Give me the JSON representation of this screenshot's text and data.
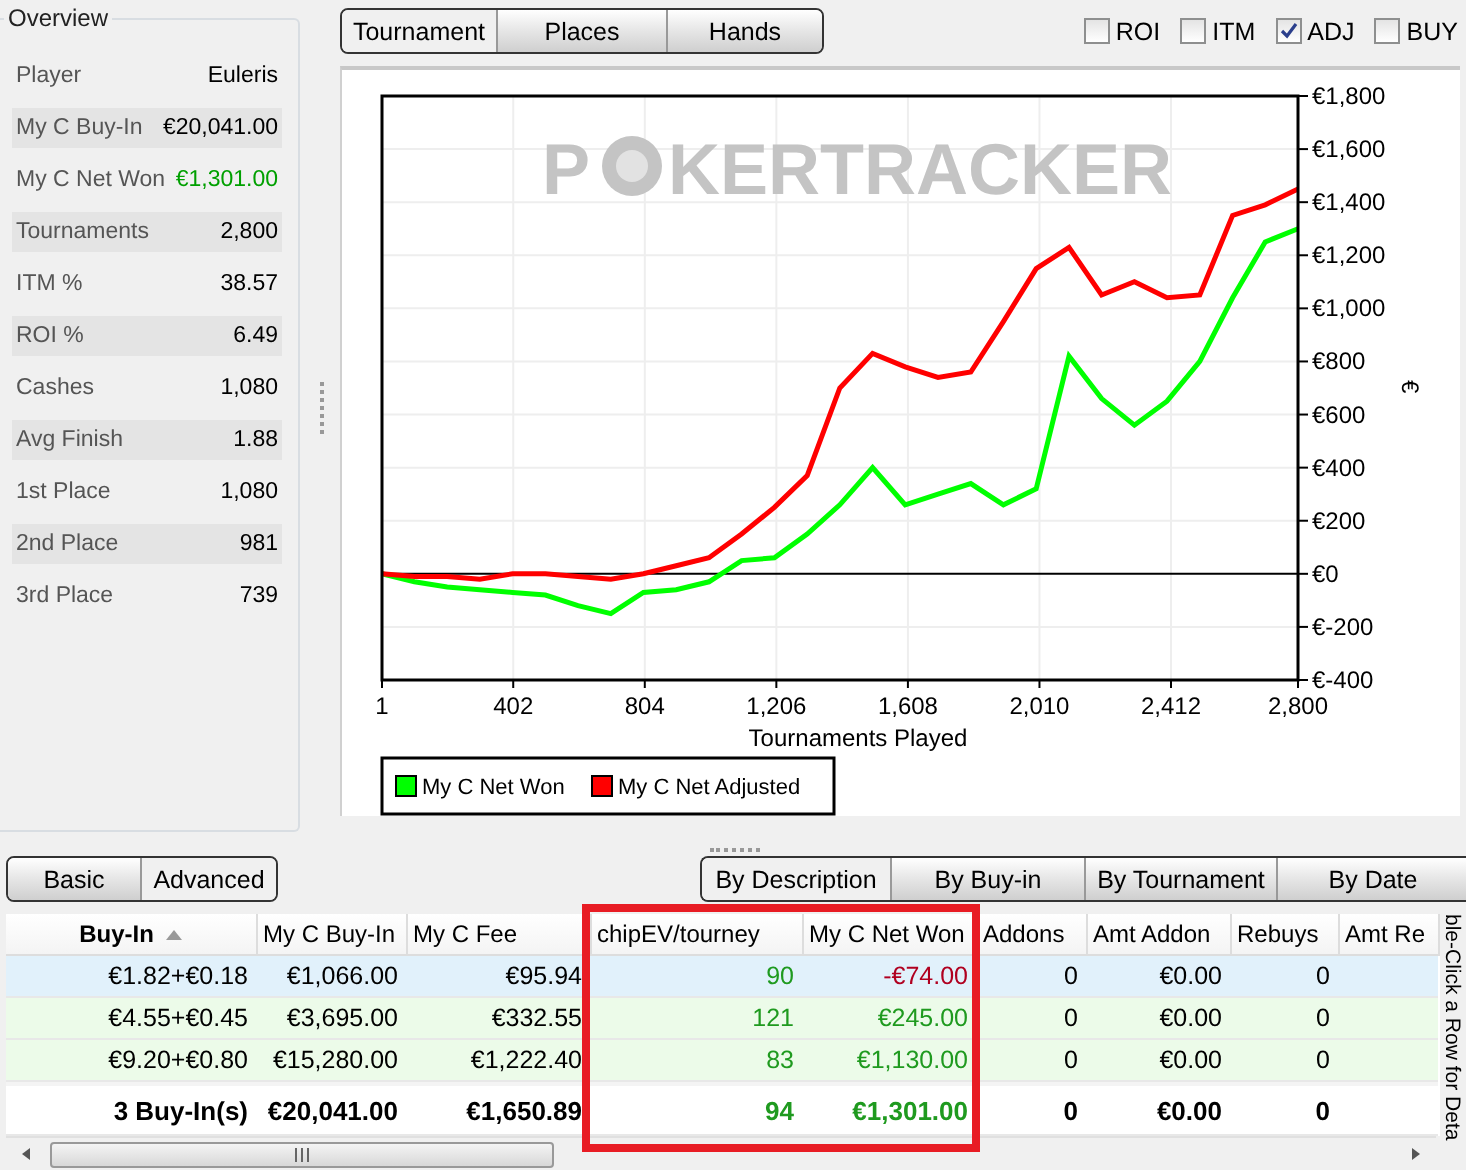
{
  "overview": {
    "title": "Overview",
    "rows": [
      {
        "label": "Player",
        "value": "Euleris"
      },
      {
        "label": "My C Buy-In",
        "value": "€20,041.00"
      },
      {
        "label": "My C Net Won",
        "value": "€1,301.00",
        "color": "#00a000"
      },
      {
        "label": "Tournaments",
        "value": "2,800"
      },
      {
        "label": "ITM %",
        "value": "38.57"
      },
      {
        "label": "ROI %",
        "value": "6.49"
      },
      {
        "label": "Cashes",
        "value": "1,080"
      },
      {
        "label": "Avg Finish",
        "value": "1.88"
      },
      {
        "label": "1st Place",
        "value": "1,080"
      },
      {
        "label": "2nd Place",
        "value": "981"
      },
      {
        "label": "3rd Place",
        "value": "739"
      }
    ]
  },
  "view_tabs": [
    {
      "label": "Tournament",
      "selected": true
    },
    {
      "label": "Places",
      "selected": false
    },
    {
      "label": "Hands",
      "selected": false
    }
  ],
  "options": [
    {
      "label": "ROI",
      "checked": false
    },
    {
      "label": "ITM",
      "checked": false
    },
    {
      "label": "ADJ",
      "checked": true
    },
    {
      "label": "BUY",
      "checked": false
    }
  ],
  "chart": {
    "watermark": [
      "P",
      "KERTRACKER"
    ],
    "chart_data": {
      "type": "line",
      "grid": true,
      "legend": true,
      "xlabel": "Tournaments Played",
      "ylabel": "€",
      "x": [
        1,
        100,
        200,
        300,
        400,
        500,
        600,
        700,
        800,
        900,
        1000,
        1100,
        1200,
        1300,
        1400,
        1500,
        1600,
        1700,
        1800,
        1900,
        2000,
        2100,
        2200,
        2300,
        2400,
        2500,
        2600,
        2700,
        2800
      ],
      "series": [
        {
          "name": "My C Net Won",
          "color": "#00ff00",
          "values": [
            0,
            -30,
            -50,
            -60,
            -70,
            -80,
            -120,
            -150,
            -70,
            -60,
            -30,
            50,
            60,
            150,
            260,
            400,
            260,
            300,
            340,
            260,
            320,
            820,
            660,
            560,
            650,
            800,
            1040,
            1250,
            1300
          ]
        },
        {
          "name": "My C Net Adjusted",
          "color": "#ff0000",
          "values": [
            0,
            -10,
            -10,
            -20,
            0,
            0,
            -10,
            -20,
            0,
            30,
            60,
            150,
            250,
            370,
            700,
            830,
            780,
            740,
            760,
            950,
            1150,
            1230,
            1050,
            1100,
            1040,
            1050,
            1350,
            1390,
            1450
          ]
        }
      ],
      "xlim": [
        1,
        2800
      ],
      "ylim": [
        -400,
        1800
      ],
      "xticks": [
        {
          "value": 1,
          "label": "1"
        },
        {
          "value": 402,
          "label": "402"
        },
        {
          "value": 804,
          "label": "804"
        },
        {
          "value": 1206,
          "label": "1,206"
        },
        {
          "value": 1608,
          "label": "1,608"
        },
        {
          "value": 2010,
          "label": "2,010"
        },
        {
          "value": 2412,
          "label": "2,412"
        },
        {
          "value": 2800,
          "label": "2,800"
        }
      ],
      "yticks": [
        {
          "value": 1800,
          "label": "€1,800"
        },
        {
          "value": 1600,
          "label": "€1,600"
        },
        {
          "value": 1400,
          "label": "€1,400"
        },
        {
          "value": 1200,
          "label": "€1,200"
        },
        {
          "value": 1000,
          "label": "€1,000"
        },
        {
          "value": 800,
          "label": "€800"
        },
        {
          "value": 600,
          "label": "€600"
        },
        {
          "value": 400,
          "label": "€400"
        },
        {
          "value": 200,
          "label": "€200"
        },
        {
          "value": 0,
          "label": "€0"
        },
        {
          "value": -200,
          "label": "€-200"
        },
        {
          "value": -400,
          "label": "€-400"
        }
      ]
    }
  },
  "mode_tabs": [
    {
      "label": "Basic",
      "selected": false
    },
    {
      "label": "Advanced",
      "selected": true
    }
  ],
  "group_tabs": [
    {
      "label": "By Description",
      "selected": true
    },
    {
      "label": "By Buy-in",
      "selected": false
    },
    {
      "label": "By Tournament",
      "selected": false
    },
    {
      "label": "By Date",
      "selected": false
    }
  ],
  "table": {
    "columns": [
      {
        "label": "Buy-In",
        "sorted": true,
        "highlighted": false
      },
      {
        "label": "My C Buy-In",
        "highlighted": false
      },
      {
        "label": "My C Fee",
        "highlighted": false
      },
      {
        "label": "chipEV/tourney",
        "highlighted": true
      },
      {
        "label": "My C Net Won",
        "highlighted": true
      },
      {
        "label": "Addons",
        "highlighted": false
      },
      {
        "label": "Amt Addon",
        "highlighted": false
      },
      {
        "label": "Rebuys",
        "highlighted": false
      },
      {
        "label": "Amt Re",
        "highlighted": false
      }
    ],
    "rows": [
      {
        "selected": true,
        "cells": [
          "€1.82+€0.18",
          "€1,066.00",
          "€95.94",
          {
            "text": "90",
            "color": "#1f9a1f"
          },
          {
            "text": "-€74.00",
            "color": "#b00020"
          },
          "0",
          "€0.00",
          "0",
          ""
        ]
      },
      {
        "selected": false,
        "cells": [
          "€4.55+€0.45",
          "€3,695.00",
          "€332.55",
          {
            "text": "121",
            "color": "#1f9a1f"
          },
          {
            "text": "€245.00",
            "color": "#1f9a1f"
          },
          "0",
          "€0.00",
          "0",
          ""
        ]
      },
      {
        "selected": false,
        "cells": [
          "€9.20+€0.80",
          "€15,280.00",
          "€1,222.40",
          {
            "text": "83",
            "color": "#1f9a1f"
          },
          {
            "text": "€1,130.00",
            "color": "#1f9a1f"
          },
          "0",
          "€0.00",
          "0",
          ""
        ]
      }
    ],
    "total": {
      "cells": [
        "3 Buy-In(s)",
        "€20,041.00",
        "€1,650.89",
        {
          "text": "94",
          "color": "#1f9a1f"
        },
        {
          "text": "€1,301.00",
          "color": "#1f9a1f"
        },
        "0",
        "€0.00",
        "0",
        ""
      ]
    }
  },
  "hint": "ble-Click a Row for Deta"
}
